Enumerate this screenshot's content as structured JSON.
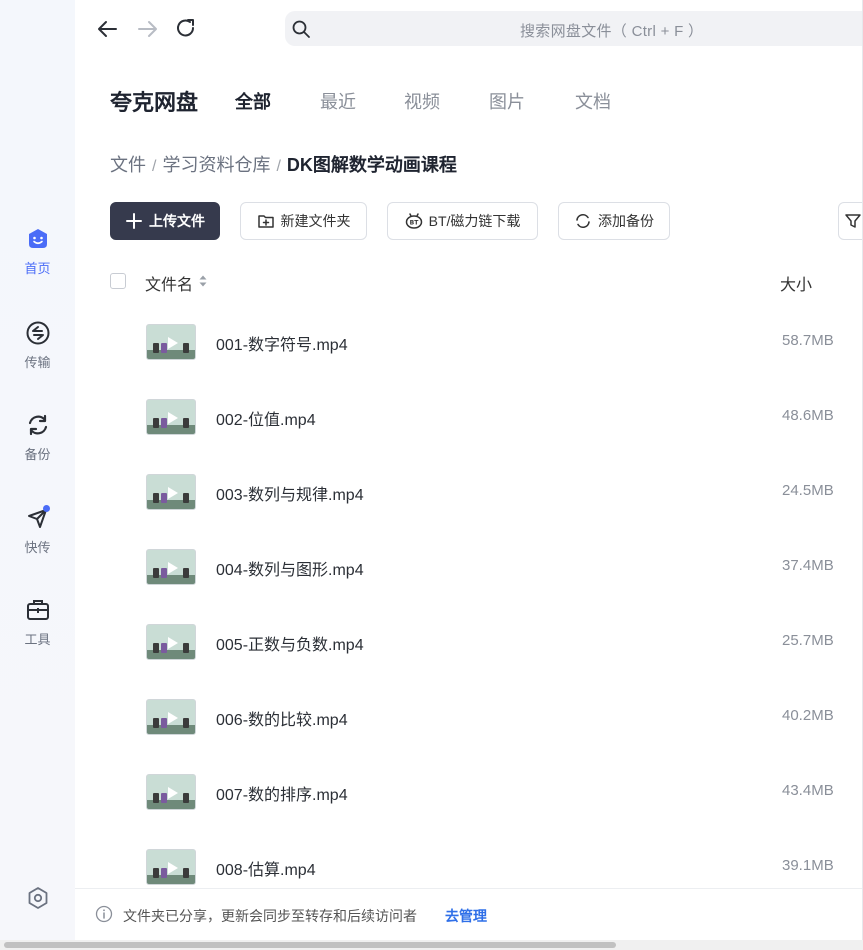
{
  "sidebar": {
    "items": [
      {
        "label": "首页",
        "icon": "home-icon"
      },
      {
        "label": "传输",
        "icon": "transfer-icon"
      },
      {
        "label": "备份",
        "icon": "backup-icon"
      },
      {
        "label": "快传",
        "icon": "quick-send-icon"
      },
      {
        "label": "工具",
        "icon": "toolbox-icon"
      }
    ],
    "settings_icon": "settings-icon",
    "accent": "#4a6cf7"
  },
  "topbar": {
    "search_placeholder": "搜索网盘文件（ Ctrl + F ）"
  },
  "header": {
    "brand": "夸克网盘",
    "tabs": [
      "全部",
      "最近",
      "视频",
      "图片",
      "文档"
    ],
    "active_tab": "全部"
  },
  "breadcrumb": [
    "文件",
    "学习资料仓库",
    "DK图解数学动画课程"
  ],
  "actions": {
    "upload": "上传文件",
    "new_folder": "新建文件夹",
    "bt_download": "BT/磁力链下载",
    "add_backup": "添加备份"
  },
  "table": {
    "col_name": "文件名",
    "col_size": "大小",
    "rows": [
      {
        "name": "001-数字符号.mp4",
        "size": "58.7MB"
      },
      {
        "name": "002-位值.mp4",
        "size": "48.6MB"
      },
      {
        "name": "003-数列与规律.mp4",
        "size": "24.5MB"
      },
      {
        "name": "004-数列与图形.mp4",
        "size": "37.4MB"
      },
      {
        "name": "005-正数与负数.mp4",
        "size": "25.7MB"
      },
      {
        "name": "006-数的比较.mp4",
        "size": "40.2MB"
      },
      {
        "name": "007-数的排序.mp4",
        "size": "43.4MB"
      },
      {
        "name": "008-估算.mp4",
        "size": "39.1MB"
      }
    ]
  },
  "notice": {
    "message": "文件夹已分享，更新会同步至转存和后续访问者",
    "manage": "去管理"
  }
}
